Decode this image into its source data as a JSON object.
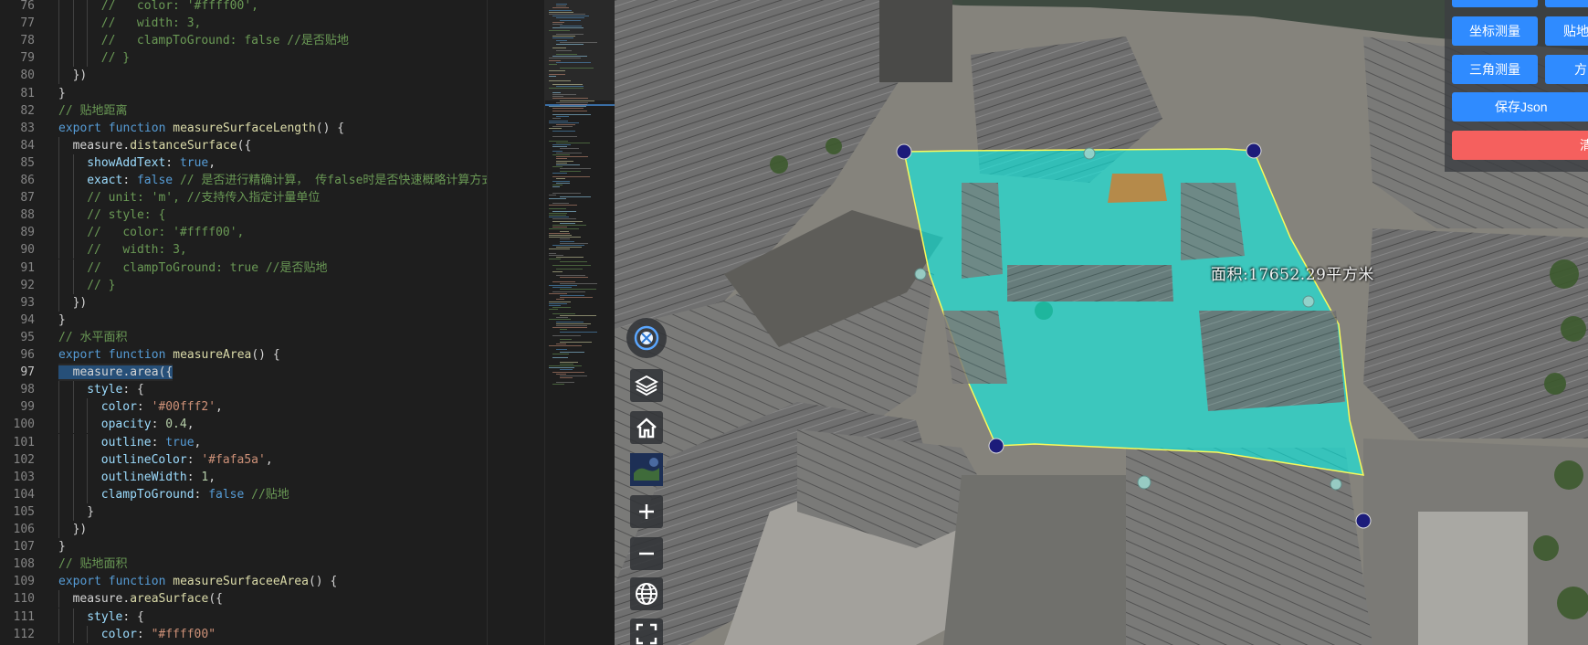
{
  "editor": {
    "active_line": "97",
    "lines": [
      {
        "n": "76",
        "t": [
          [
            "ig",
            3
          ],
          [
            "cm",
            "//   color: '#ffff00',"
          ]
        ]
      },
      {
        "n": "77",
        "t": [
          [
            "ig",
            3
          ],
          [
            "cm",
            "//   width: 3,"
          ]
        ]
      },
      {
        "n": "78",
        "t": [
          [
            "ig",
            3
          ],
          [
            "cm",
            "//   clampToGround: false //是否贴地"
          ]
        ]
      },
      {
        "n": "79",
        "t": [
          [
            "ig",
            3
          ],
          [
            "cm",
            "// }"
          ]
        ]
      },
      {
        "n": "80",
        "t": [
          [
            "ig",
            1
          ],
          [
            "pn",
            "})"
          ]
        ]
      },
      {
        "n": "81",
        "t": [
          [
            "pn",
            "}"
          ]
        ]
      },
      {
        "n": "82",
        "t": [
          [
            "cm",
            "// 贴地距离"
          ]
        ]
      },
      {
        "n": "83",
        "t": [
          [
            "kw",
            "export"
          ],
          [
            "pn",
            " "
          ],
          [
            "kw",
            "function"
          ],
          [
            "pn",
            " "
          ],
          [
            "fn",
            "measureSurfaceLength"
          ],
          [
            "pn",
            "() {"
          ]
        ]
      },
      {
        "n": "84",
        "t": [
          [
            "ig",
            1
          ],
          [
            "pn",
            "measure."
          ],
          [
            "fn",
            "distanceSurface"
          ],
          [
            "pn",
            "({"
          ]
        ]
      },
      {
        "n": "85",
        "t": [
          [
            "ig",
            2
          ],
          [
            "prop",
            "showAddText"
          ],
          [
            "pn",
            ": "
          ],
          [
            "kw",
            "true"
          ],
          [
            "pn",
            ","
          ]
        ]
      },
      {
        "n": "86",
        "t": [
          [
            "ig",
            2
          ],
          [
            "prop",
            "exact"
          ],
          [
            "pn",
            ": "
          ],
          [
            "kw",
            "false"
          ],
          [
            "pn",
            " "
          ],
          [
            "cm",
            "// 是否进行精确计算， 传false时是否快速概略计算方式，该方式计算精度较低，但计算速度快"
          ]
        ]
      },
      {
        "n": "87",
        "t": [
          [
            "ig",
            2
          ],
          [
            "cm",
            "// unit: 'm', //支持传入指定计量单位"
          ]
        ]
      },
      {
        "n": "88",
        "t": [
          [
            "ig",
            2
          ],
          [
            "cm",
            "// style: {"
          ]
        ]
      },
      {
        "n": "89",
        "t": [
          [
            "ig",
            2
          ],
          [
            "cm",
            "//   color: '#ffff00',"
          ]
        ]
      },
      {
        "n": "90",
        "t": [
          [
            "ig",
            2
          ],
          [
            "cm",
            "//   width: 3,"
          ]
        ]
      },
      {
        "n": "91",
        "t": [
          [
            "ig",
            2
          ],
          [
            "cm",
            "//   clampToGround: true //是否贴地"
          ]
        ]
      },
      {
        "n": "92",
        "t": [
          [
            "ig",
            2
          ],
          [
            "cm",
            "// }"
          ]
        ]
      },
      {
        "n": "93",
        "t": [
          [
            "ig",
            1
          ],
          [
            "pn",
            "})"
          ]
        ]
      },
      {
        "n": "94",
        "t": [
          [
            "pn",
            "}"
          ]
        ]
      },
      {
        "n": "95",
        "t": [
          [
            "cm",
            "// 水平面积"
          ]
        ]
      },
      {
        "n": "96",
        "t": [
          [
            "kw",
            "export"
          ],
          [
            "pn",
            " "
          ],
          [
            "kw",
            "function"
          ],
          [
            "pn",
            " "
          ],
          [
            "fn",
            "measureArea"
          ],
          [
            "pn",
            "() {"
          ]
        ]
      },
      {
        "n": "97",
        "t": [
          [
            "sel",
            "  measure.area({"
          ]
        ]
      },
      {
        "n": "98",
        "t": [
          [
            "ig",
            2
          ],
          [
            "prop",
            "style"
          ],
          [
            "pn",
            ": {"
          ]
        ]
      },
      {
        "n": "99",
        "t": [
          [
            "ig",
            3
          ],
          [
            "prop",
            "color"
          ],
          [
            "pn",
            ": "
          ],
          [
            "str",
            "'#00fff2'"
          ],
          [
            "pn",
            ","
          ]
        ]
      },
      {
        "n": "100",
        "t": [
          [
            "ig",
            3
          ],
          [
            "prop",
            "opacity"
          ],
          [
            "pn",
            ": "
          ],
          [
            "num",
            "0.4"
          ],
          [
            "pn",
            ","
          ]
        ]
      },
      {
        "n": "101",
        "t": [
          [
            "ig",
            3
          ],
          [
            "prop",
            "outline"
          ],
          [
            "pn",
            ": "
          ],
          [
            "kw",
            "true"
          ],
          [
            "pn",
            ","
          ]
        ]
      },
      {
        "n": "102",
        "t": [
          [
            "ig",
            3
          ],
          [
            "prop",
            "outlineColor"
          ],
          [
            "pn",
            ": "
          ],
          [
            "str",
            "'#fafa5a'"
          ],
          [
            "pn",
            ","
          ]
        ]
      },
      {
        "n": "103",
        "t": [
          [
            "ig",
            3
          ],
          [
            "prop",
            "outlineWidth"
          ],
          [
            "pn",
            ": "
          ],
          [
            "num",
            "1"
          ],
          [
            "pn",
            ","
          ]
        ]
      },
      {
        "n": "104",
        "t": [
          [
            "ig",
            3
          ],
          [
            "prop",
            "clampToGround"
          ],
          [
            "pn",
            ": "
          ],
          [
            "kw",
            "false"
          ],
          [
            "pn",
            " "
          ],
          [
            "cm",
            "//贴地"
          ]
        ]
      },
      {
        "n": "105",
        "t": [
          [
            "ig",
            2
          ],
          [
            "pn",
            "}"
          ]
        ]
      },
      {
        "n": "106",
        "t": [
          [
            "ig",
            1
          ],
          [
            "pn",
            "})"
          ]
        ]
      },
      {
        "n": "107",
        "t": [
          [
            "pn",
            "}"
          ]
        ]
      },
      {
        "n": "108",
        "t": [
          [
            "cm",
            "// 贴地面积"
          ]
        ]
      },
      {
        "n": "109",
        "t": [
          [
            "kw",
            "export"
          ],
          [
            "pn",
            " "
          ],
          [
            "kw",
            "function"
          ],
          [
            "pn",
            " "
          ],
          [
            "fn",
            "measureSurfaceeArea"
          ],
          [
            "pn",
            "() {"
          ]
        ]
      },
      {
        "n": "110",
        "t": [
          [
            "ig",
            1
          ],
          [
            "pn",
            "measure."
          ],
          [
            "fn",
            "areaSurface"
          ],
          [
            "pn",
            "({"
          ]
        ]
      },
      {
        "n": "111",
        "t": [
          [
            "ig",
            2
          ],
          [
            "prop",
            "style"
          ],
          [
            "pn",
            ": {"
          ]
        ]
      },
      {
        "n": "112",
        "t": [
          [
            "ig",
            3
          ],
          [
            "prop",
            "color"
          ],
          [
            "pn",
            ": "
          ],
          [
            "str",
            "\"#ffff00\""
          ]
        ]
      }
    ],
    "colors": {
      "background": "#1e1e1e",
      "keyword": "#569cd6",
      "function": "#dcdcaa",
      "string": "#ce9178",
      "comment": "#6a9955",
      "property": "#9cdcfe",
      "number": "#b5cea8",
      "selection": "#264f78"
    }
  },
  "map": {
    "area_label": "面积:17652.29平方米",
    "measure_fill_color": "#00fff2",
    "measure_outline_color": "#fafa5a",
    "nav_icons": [
      "compass-icon",
      "layers-icon",
      "home-icon",
      "basemap-thumbnail",
      "zoom-in-icon",
      "zoom-out-icon",
      "globe-icon",
      "fullscreen-icon"
    ],
    "tools": {
      "coord_measure": "坐标测量",
      "surface_partial": "贴地",
      "triangle_measure": "三角测量",
      "azimuth_partial": "方",
      "save_json": "保存Json",
      "clear_partial": "清"
    }
  }
}
